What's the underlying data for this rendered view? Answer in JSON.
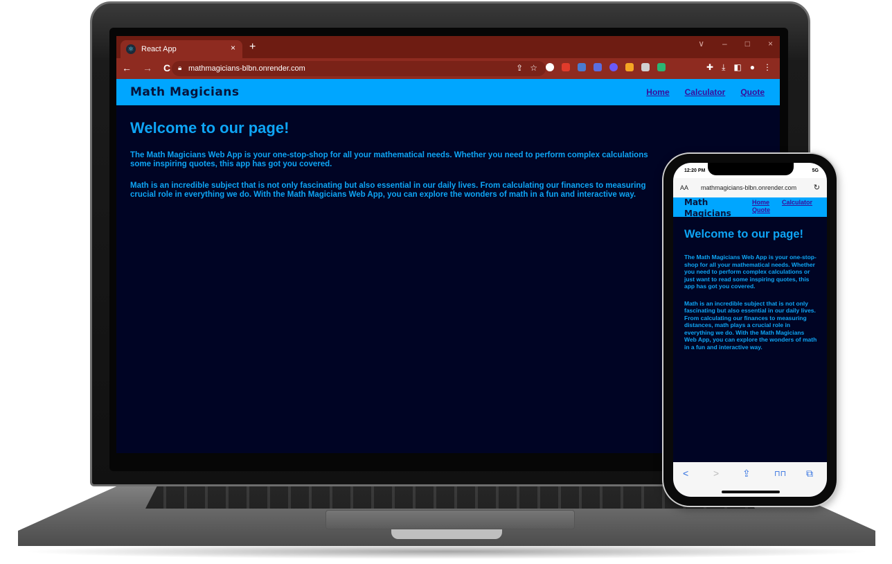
{
  "browser": {
    "tab_title": "React App",
    "tab_close": "×",
    "new_tab": "+",
    "url": "mathmagicians-blbn.onrender.com",
    "nav": {
      "back": "←",
      "forward": "→",
      "reload": "C"
    },
    "window_controls": [
      "∨",
      "–",
      "□",
      "×"
    ],
    "extension_colors": [
      "#ffffff",
      "#e13b2b",
      "#4a7bd0",
      "#5a6ee0",
      "#6a5af9",
      "#f5a623",
      "#d0d0d0",
      "#2bb673",
      "#f0f0f0"
    ]
  },
  "site": {
    "brand": "Math Magicians",
    "nav_links": {
      "home": "Home",
      "calculator": "Calculator",
      "quote": "Quote"
    },
    "title": "Welcome to our page!",
    "paragraph_1": "The Math Magicians Web App is your one-stop-shop for all your mathematical needs. Whether you need to perform complex calculations or just want to read some inspiring quotes, this app has got you covered.",
    "paragraph_2": "Math is an incredible subject that is not only fascinating but also essential in our daily lives. From calculating our finances to measuring distances, math plays a crucial role in everything we do. With the Math Magicians Web App, you can explore the wonders of math in a fun and interactive way."
  },
  "laptop_visible": {
    "paragraph_1_line_1": "The Math Magicians Web App is your one-stop-shop for all your mathematical needs. Whether you need to perform complex calculations",
    "paragraph_1_line_2": "some inspiring quotes, this app has got you covered.",
    "paragraph_2_line_1": "Math is an incredible subject that is not only fascinating but also essential in our daily lives. From calculating our finances to measuring",
    "paragraph_2_line_2": "crucial role in everything we do. With the Math Magicians Web App, you can explore the wonders of math in a fun and interactive way."
  },
  "phone": {
    "time": "12:20 PM",
    "signal": "5G",
    "text_size": "AA",
    "url": "mathmagicians-blbn.onrender.com",
    "reload": "↻",
    "toolbar": {
      "back": "<",
      "forward": ">",
      "share": "⇪",
      "bookmarks": "⊓⊓",
      "tabs": "⧉"
    }
  },
  "colors": {
    "page_background": "#000424",
    "nav_background": "#00a6ff",
    "text_accent": "#0ea5f5",
    "browser_frame": "#8e2b20"
  }
}
